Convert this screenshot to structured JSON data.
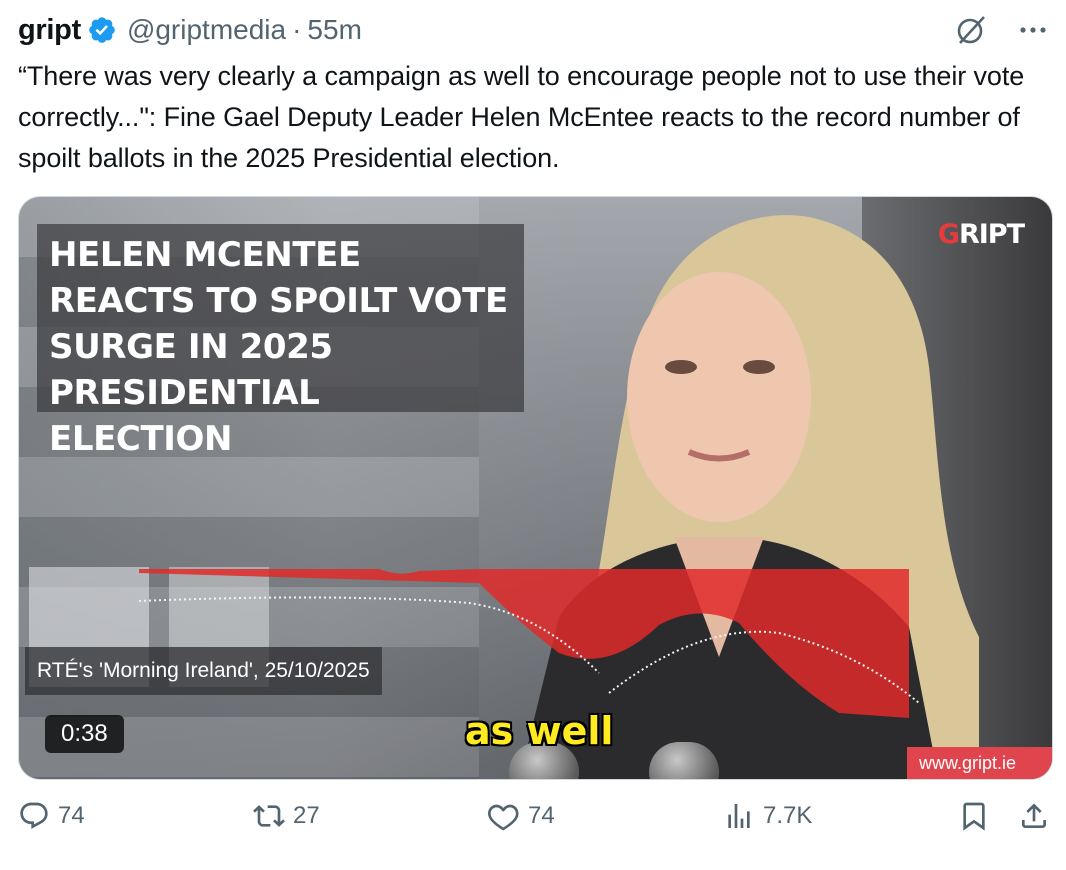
{
  "author": {
    "name": "gript",
    "handle": "@griptmedia",
    "separator": "·",
    "time": "55m",
    "verified": true
  },
  "icons": {
    "verified": "verified-badge-icon",
    "grok": "grok-icon",
    "more": "more-options-icon",
    "reply": "reply-icon",
    "retweet": "retweet-icon",
    "like": "like-icon",
    "views": "views-icon",
    "bookmark": "bookmark-icon",
    "share": "share-icon"
  },
  "tweet": {
    "text": "“There was very clearly a campaign as well to encourage people not to use their vote correctly...\": Fine Gael Deputy Leader Helen McEntee reacts to the record number of spoilt ballots in the 2025 Presidential election."
  },
  "video": {
    "headline": "HELEN MCENTEE REACTS TO SPOILT VOTE SURGE IN 2025 PRESIDENTIAL ELECTION",
    "brand": "RIPT",
    "brand_letter": "G",
    "source": "RTÉ's 'Morning Ireland', 25/10/2025",
    "duration": "0:38",
    "caption": "as well",
    "site": "www.gript.ie"
  },
  "stats": {
    "replies": "74",
    "retweets": "27",
    "likes": "74",
    "views": "7.7K"
  },
  "colors": {
    "text": "#0f1419",
    "secondary": "#536471",
    "verified": "#1d9bf0",
    "brand_red": "#e63b3b",
    "caption_yellow": "#ffeb1f"
  }
}
